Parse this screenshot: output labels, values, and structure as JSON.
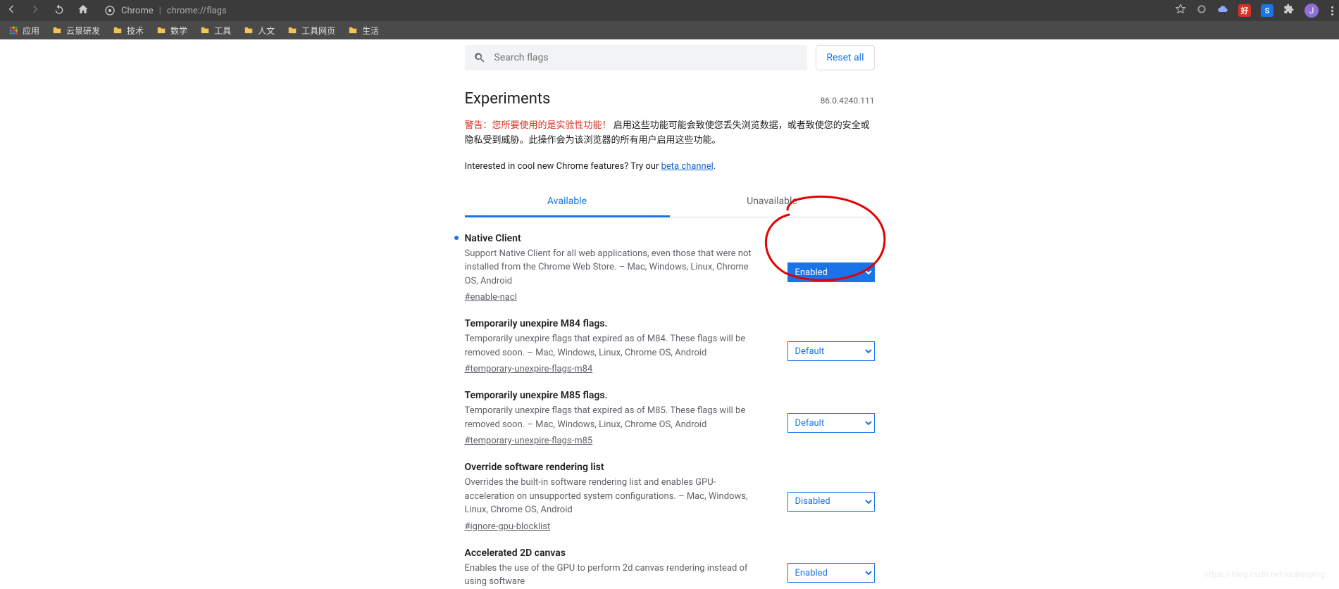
{
  "browser": {
    "site_label": "Chrome",
    "url": "chrome://flags",
    "avatar_letter": "J"
  },
  "bookmarks_label": "应用",
  "bookmarks": [
    "云景研发",
    "技术",
    "数学",
    "工具",
    "人文",
    "工具网页",
    "生活"
  ],
  "search": {
    "placeholder": "Search flags"
  },
  "reset_label": "Reset all",
  "title": "Experiments",
  "version": "86.0.4240.111",
  "warning_red": "警告：您所要使用的是实验性功能！",
  "warning_rest": "启用这些功能可能会致使您丢失浏览数据，或者致使您的安全或隐私受到威胁。此操作会为该浏览器的所有用户启用这些功能。",
  "beta_prefix": "Interested in cool new Chrome features? Try our ",
  "beta_link": "beta channel",
  "beta_suffix": ".",
  "tabs": {
    "available": "Available",
    "unavailable": "Unavailable"
  },
  "select_options": [
    "Default",
    "Enabled",
    "Disabled"
  ],
  "flags": [
    {
      "name": "Native Client",
      "desc": "Support Native Client for all web applications, even those that were not installed from the Chrome Web Store. – Mac, Windows, Linux, Chrome OS, Android",
      "hash": "#enable-nacl",
      "value": "Enabled",
      "primary": true,
      "dot": true
    },
    {
      "name": "Temporarily unexpire M84 flags.",
      "desc": "Temporarily unexpire flags that expired as of M84. These flags will be removed soon. – Mac, Windows, Linux, Chrome OS, Android",
      "hash": "#temporary-unexpire-flags-m84",
      "value": "Default",
      "primary": false,
      "dot": false
    },
    {
      "name": "Temporarily unexpire M85 flags.",
      "desc": "Temporarily unexpire flags that expired as of M85. These flags will be removed soon. – Mac, Windows, Linux, Chrome OS, Android",
      "hash": "#temporary-unexpire-flags-m85",
      "value": "Default",
      "primary": false,
      "dot": false
    },
    {
      "name": "Override software rendering list",
      "desc": "Overrides the built-in software rendering list and enables GPU-acceleration on unsupported system configurations. – Mac, Windows, Linux, Chrome OS, Android",
      "hash": "#ignore-gpu-blocklist",
      "value": "Disabled",
      "primary": false,
      "dot": false
    },
    {
      "name": "Accelerated 2D canvas",
      "desc": "Enables the use of the GPU to perform 2d canvas rendering instead of using software",
      "hash": "",
      "value": "Enabled",
      "primary": false,
      "dot": false
    }
  ],
  "watermark": "https://blog.csdn.net/oujianping"
}
